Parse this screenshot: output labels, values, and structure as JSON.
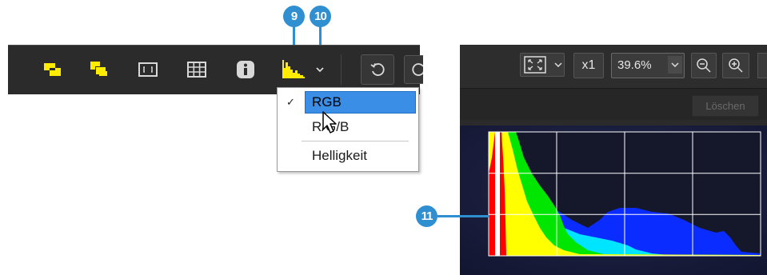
{
  "callouts": {
    "badge_9": "9",
    "badge_10": "10",
    "badge_11": "11"
  },
  "toolbar": {
    "icons": [
      "overlay-icon",
      "overlay-alt-icon",
      "crop-frame-icon",
      "grid-icon",
      "info-icon",
      "histogram-icon",
      "chevron-down-icon",
      "rotate-icon"
    ]
  },
  "dropdown": {
    "items": [
      {
        "label": "RGB",
        "checked": true,
        "selected": true
      },
      {
        "label": "R/G/B",
        "checked": false,
        "selected": false
      },
      {
        "label": "Helligkeit",
        "checked": false,
        "selected": false
      }
    ],
    "check_glyph": "✓"
  },
  "viewer": {
    "scale_label": "x1",
    "zoom_value": "39.6%",
    "clear_label": "Löschen"
  },
  "colors": {
    "toolbar_bg": "#2b2b2b",
    "icon_yellow": "#ffec00",
    "callout_blue": "#2f8fd0",
    "selection_blue": "#3a8ee6",
    "histogram_bg": "#1a1d3a"
  }
}
